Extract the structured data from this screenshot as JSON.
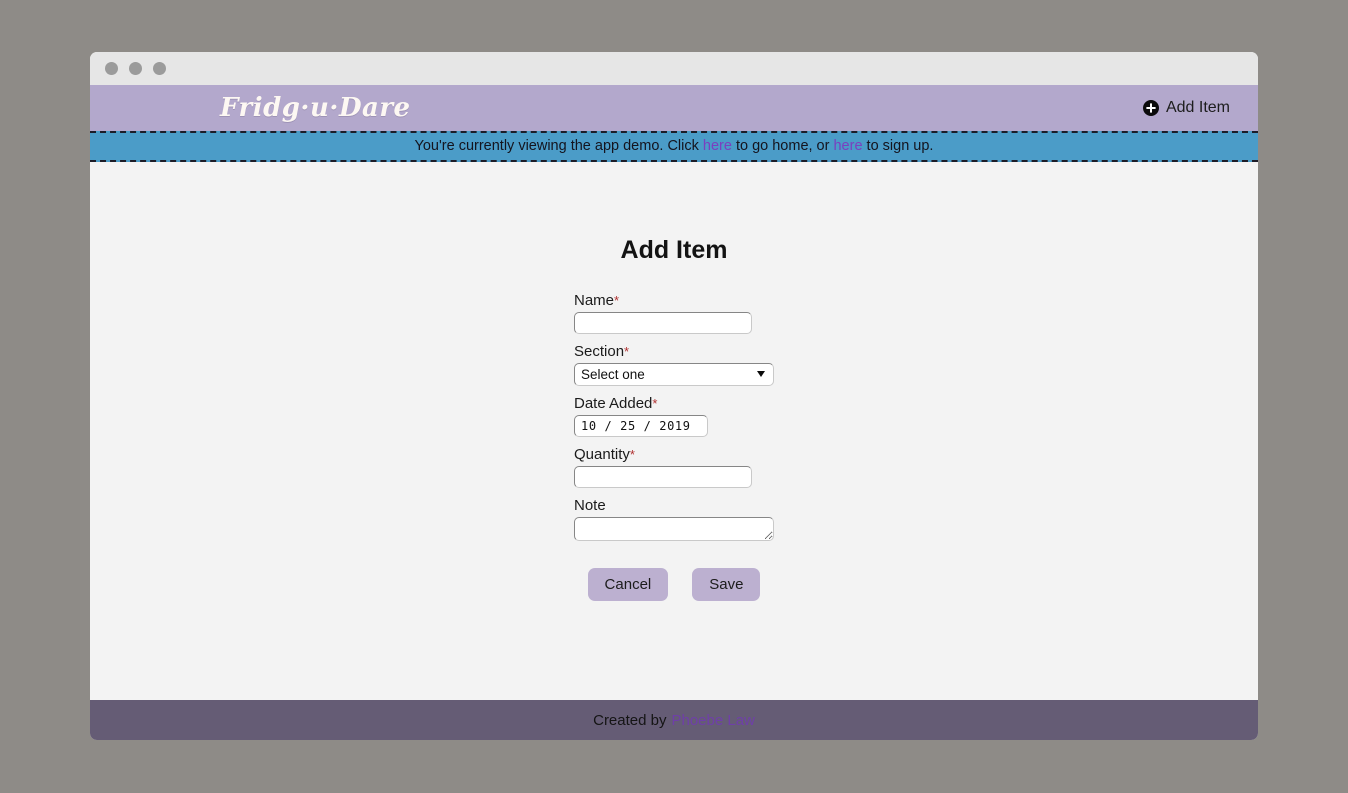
{
  "window": {
    "traffic_lights": [
      "close",
      "minimize",
      "maximize"
    ]
  },
  "header": {
    "brand": "Fridg·u·Dare",
    "add_item_label": "Add Item",
    "add_item_icon": "plus-circle-icon",
    "background": "#b3a8cc"
  },
  "banner": {
    "text_before": "You're currently viewing the app demo. Click",
    "link_home": "here",
    "text_middle": "to go home, or",
    "link_signup": "here",
    "text_after": "to sign up.",
    "background": "#4b9cc8",
    "link_color": "#7b3fbf"
  },
  "main": {
    "title": "Add Item",
    "fields": [
      {
        "label": "Name",
        "required": true,
        "value": "",
        "type": "text"
      },
      {
        "label": "Section",
        "required": true,
        "value": "Select one",
        "type": "select",
        "options": [
          "Select one"
        ]
      },
      {
        "label": "Date Added",
        "required": true,
        "value": "10 / 25 / 2019",
        "type": "date"
      },
      {
        "label": "Quantity",
        "required": true,
        "value": "",
        "type": "text"
      },
      {
        "label": "Note",
        "required": false,
        "value": "",
        "type": "textarea"
      }
    ],
    "required_marker": "*",
    "buttons": {
      "cancel": "Cancel",
      "save": "Save",
      "color": "#bcb0d0"
    }
  },
  "footer": {
    "text": "Created by",
    "author": "Phoebe Law",
    "background": "#655c75",
    "link_color": "#6f3fa8"
  }
}
